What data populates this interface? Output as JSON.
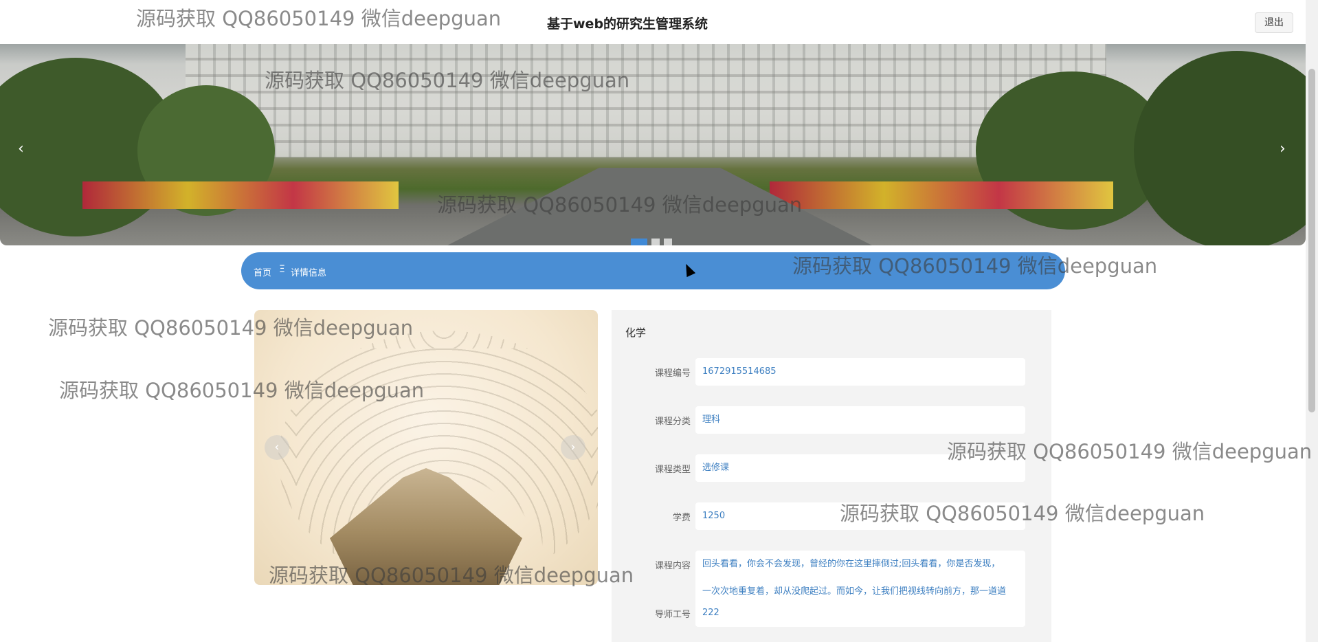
{
  "header": {
    "title": "基于web的研究生管理系统",
    "logout_label": "退出"
  },
  "banner": {
    "prev_icon": "‹",
    "next_icon": "›",
    "slide_count": 3,
    "active_slide": 1
  },
  "breadcrumb": {
    "home": "首页",
    "separator": "Ξ",
    "current": "详情信息"
  },
  "gallery": {
    "prev_icon": "‹",
    "next_icon": "›"
  },
  "detail": {
    "title": "化学",
    "fields": [
      {
        "label": "课程编号",
        "value": "1672915514685"
      },
      {
        "label": "课程分类",
        "value": "理科"
      },
      {
        "label": "课程类型",
        "value": "选修课"
      },
      {
        "label": "学费",
        "value": "1250"
      },
      {
        "label": "课程内容",
        "value": "回头看看，你会不会发现，曾经的你在这里摔倒过;回头看看，你是否发现，\n一次次地重复着，却从没爬起过。而如今，让我们把视线转向前方，那一道道"
      },
      {
        "label": "导师工号",
        "value": "222"
      }
    ]
  },
  "watermark": "源码获取 QQ86050149 微信deepguan",
  "colors": {
    "accent": "#4a8ed4",
    "value_text": "#3d7fc1",
    "panel_bg": "#f3f3f3"
  }
}
